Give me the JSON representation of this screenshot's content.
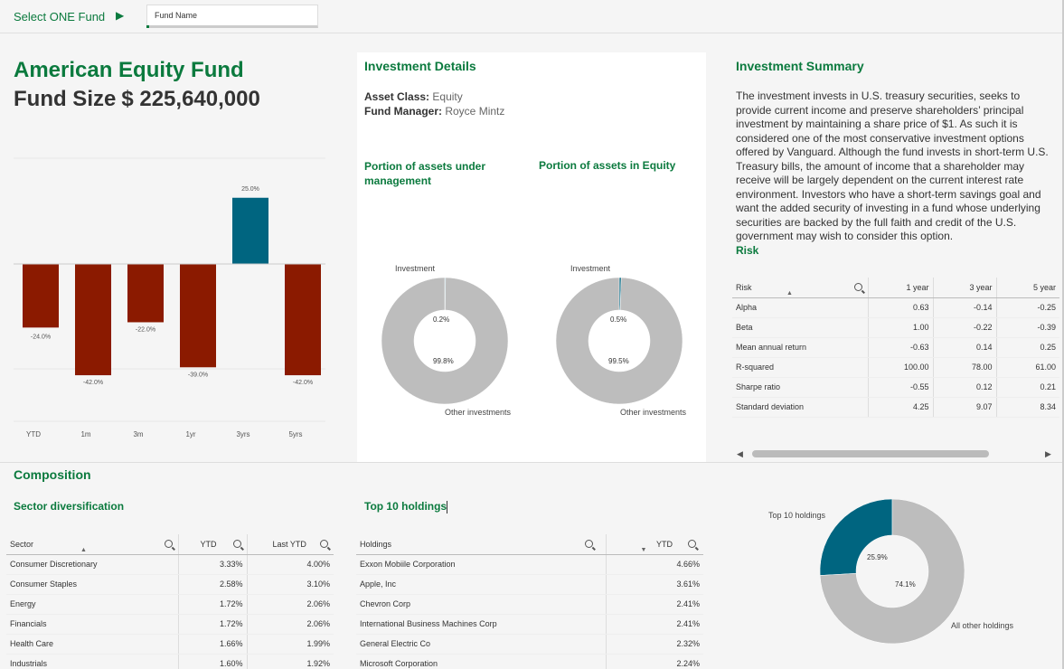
{
  "selector": {
    "label": "Select ONE Fund",
    "field_label": "Fund Name"
  },
  "fund": {
    "name": "American Equity Fund",
    "size_label": "Fund Size",
    "size_value": "$ 225,640,000"
  },
  "performance_chart": {
    "categories": [
      "YTD",
      "1m",
      "3m",
      "1yr",
      "3yrs",
      "5yrs"
    ],
    "labels": [
      "-24.0%",
      "-42.0%",
      "-22.0%",
      "-39.0%",
      "25.0%",
      "-42.0%"
    ]
  },
  "chart_data": [
    {
      "type": "bar",
      "categories": [
        "YTD",
        "1m",
        "3m",
        "1yr",
        "3yrs",
        "5yrs"
      ],
      "values": [
        -24.0,
        -42.0,
        -22.0,
        -39.0,
        25.0,
        -42.0
      ],
      "colors": {
        "negative": "#8b1a00",
        "positive": "#006580"
      }
    },
    {
      "type": "pie",
      "title": "Portion of assets under management",
      "labels": [
        "Investment",
        "Other investments"
      ],
      "values": [
        0.2,
        99.8
      ]
    },
    {
      "type": "pie",
      "title": "Portion of assets in Equity",
      "labels": [
        "Investment",
        "Other investments"
      ],
      "values": [
        0.5,
        99.5
      ]
    },
    {
      "type": "pie",
      "labels": [
        "Top 10 holdings",
        "All other holdings"
      ],
      "values": [
        25.9,
        74.1
      ]
    }
  ],
  "details": {
    "title": "Investment Details",
    "asset_class_label": "Asset Class:",
    "asset_class": "Equity",
    "manager_label": "Fund Manager:",
    "manager": "Royce Mintz",
    "donut1_title": "Portion of assets under management",
    "donut2_title": "Portion of assets in Equity",
    "donut1": {
      "top_label": "Investment",
      "bottom_label": "Other investments",
      "small": "0.2%",
      "big": "99.8%"
    },
    "donut2": {
      "top_label": "Investment",
      "bottom_label": "Other investments",
      "small": "0.5%",
      "big": "99.5%"
    }
  },
  "summary": {
    "title": "Investment Summary",
    "text": "The investment invests in U.S. treasury securities, seeks to provide current income and preserve shareholders’ principal investment by maintaining a share price of $1. As such it is considered one of the most conservative investment options offered by Vanguard. Although the fund invests in short-term U.S. Treasury bills, the amount of income that a shareholder may receive will be largely dependent on the current interest rate environment. Investors who have a short-term savings goal and want the added security of investing in a fund whose underlying securities are backed by the full faith and credit of the U.S. government may wish to consider this option."
  },
  "risk": {
    "title": "Risk",
    "headers": [
      "Risk",
      "1 year",
      "3 year",
      "5 year"
    ],
    "rows": [
      [
        "Alpha",
        "0.63",
        "-0.14",
        "-0.25"
      ],
      [
        "Beta",
        "1.00",
        "-0.22",
        "-0.39"
      ],
      [
        "Mean annual return",
        "-0.63",
        "0.14",
        "0.25"
      ],
      [
        "R-squared",
        "100.00",
        "78.00",
        "61.00"
      ],
      [
        "Sharpe ratio",
        "-0.55",
        "0.12",
        "0.21"
      ],
      [
        "Standard deviation",
        "4.25",
        "9.07",
        "8.34"
      ]
    ]
  },
  "composition": {
    "title": "Composition",
    "sector_title": "Sector diversification",
    "sector_headers": [
      "Sector",
      "YTD",
      "Last YTD"
    ],
    "sector_rows": [
      [
        "Consumer Discretionary",
        "3.33%",
        "4.00%"
      ],
      [
        "Consumer Staples",
        "2.58%",
        "3.10%"
      ],
      [
        "Energy",
        "1.72%",
        "2.06%"
      ],
      [
        "Financials",
        "1.72%",
        "2.06%"
      ],
      [
        "Health Care",
        "1.66%",
        "1.99%"
      ],
      [
        "Industrials",
        "1.60%",
        "1.92%"
      ]
    ],
    "holdings_title": "Top 10 holdings",
    "holdings_headers": [
      "Holdings",
      "YTD"
    ],
    "holdings_rows": [
      [
        "Exxon Mobiile Corporation",
        "4.66%"
      ],
      [
        "Apple, Inc",
        "3.61%"
      ],
      [
        "Chevron Corp",
        "2.41%"
      ],
      [
        "International Business Machines Corp",
        "2.41%"
      ],
      [
        "General Electric Co",
        "2.32%"
      ],
      [
        "Microsoft Corporation",
        "2.24%"
      ]
    ],
    "donut": {
      "top_label": "Top 10 holdings",
      "bottom_label": "All other holdings",
      "small": "25.9%",
      "big": "74.1%"
    }
  }
}
